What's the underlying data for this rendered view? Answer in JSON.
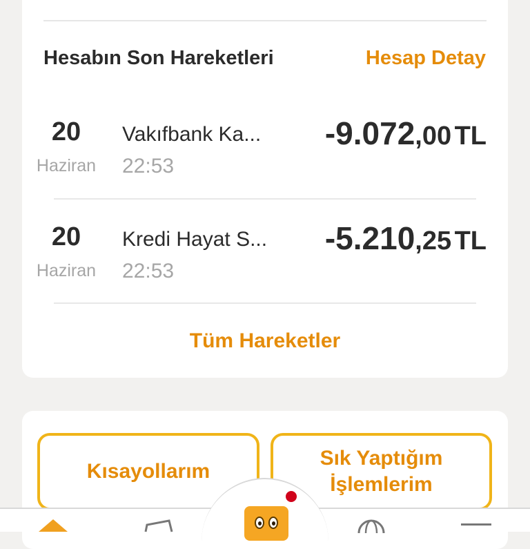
{
  "recent": {
    "title": "Hesabın Son Hareketleri",
    "detail_link": "Hesap Detay",
    "transactions": [
      {
        "day": "20",
        "month": "Haziran",
        "name": "Vakıfbank Ka...",
        "time": "22:53",
        "amount_int": "-9.072",
        "amount_dec": ",00",
        "currency": "TL"
      },
      {
        "day": "20",
        "month": "Haziran",
        "name": "Kredi Hayat S...",
        "time": "22:53",
        "amount_int": "-5.210",
        "amount_dec": ",25",
        "currency": "TL"
      }
    ],
    "all_link": "Tüm Hareketler"
  },
  "shortcuts": {
    "left_label": "Kısayollarım",
    "right_label_line1": "Sık Yaptığım",
    "right_label_line2": "İşlemlerim"
  },
  "bottom_nav": {
    "icons": [
      "home-icon",
      "wallet-icon",
      "mascot-icon",
      "globe-icon",
      "menu-icon"
    ]
  },
  "colors": {
    "accent": "#e58c0a",
    "button_border": "#f0b419",
    "notification": "#d0021b"
  }
}
